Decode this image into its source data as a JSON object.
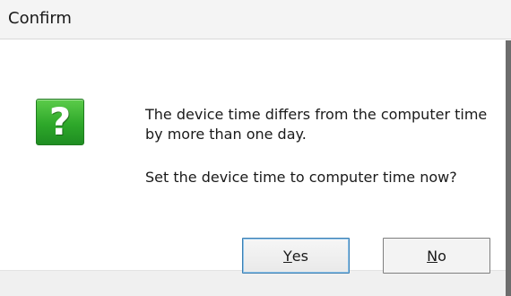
{
  "window": {
    "title": "Confirm"
  },
  "icon": "question-icon",
  "icon_glyph": "?",
  "message": {
    "line1": "The device time differs from the computer time by more than one day.",
    "line2": "Set the device time to computer time now?"
  },
  "buttons": {
    "yes": {
      "accel": "Y",
      "rest": "es"
    },
    "no": {
      "accel": "N",
      "rest": "o"
    }
  },
  "colors": {
    "icon_green": "#2ea82a",
    "default_button_border": "#3c7fb1"
  }
}
